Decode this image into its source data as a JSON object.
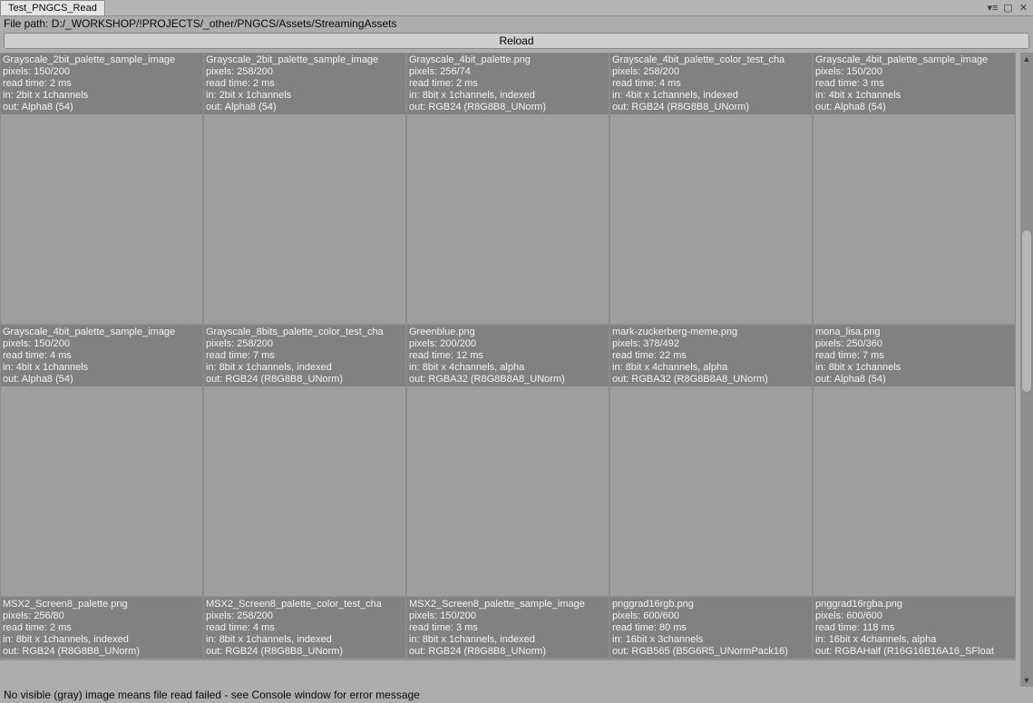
{
  "window": {
    "tab_title": "Test_PNGCS_Read"
  },
  "filepath_label": "File path: D:/_WORKSHOP/!PROJECTS/_other/PNGCS/Assets/StreamingAssets",
  "reload_label": "Reload",
  "footer_text": "No visible (gray) image means file read failed - see Console window for error message",
  "cells": [
    {
      "name": "Grayscale_2bit_palette_sample_image",
      "pixels": "150/200",
      "read_time": "2 ms",
      "in": "2bit x 1channels",
      "out": "Alpha8 (54)"
    },
    {
      "name": "Grayscale_2bit_palette_sample_image",
      "pixels": "258/200",
      "read_time": "2 ms",
      "in": "2bit x 1channels",
      "out": "Alpha8 (54)"
    },
    {
      "name": "Grayscale_4bit_palette.png",
      "pixels": "256/74",
      "read_time": "2 ms",
      "in": "8bit x 1channels, indexed",
      "out": "RGB24 (R8G8B8_UNorm)"
    },
    {
      "name": "Grayscale_4bit_palette_color_test_cha",
      "pixels": "258/200",
      "read_time": "4 ms",
      "in": "4bit x 1channels, indexed",
      "out": "RGB24 (R8G8B8_UNorm)"
    },
    {
      "name": "Grayscale_4bit_palette_sample_image",
      "pixels": "150/200",
      "read_time": "3 ms",
      "in": "4bit x 1channels",
      "out": "Alpha8 (54)"
    },
    {
      "name": "Grayscale_4bit_palette_sample_image",
      "pixels": "150/200",
      "read_time": "4 ms",
      "in": "4bit x 1channels",
      "out": "Alpha8 (54)"
    },
    {
      "name": "Grayscale_8bits_palette_color_test_cha",
      "pixels": "258/200",
      "read_time": "7 ms",
      "in": "8bit x 1channels, indexed",
      "out": "RGB24 (R8G8B8_UNorm)"
    },
    {
      "name": "Greenblue.png",
      "pixels": "200/200",
      "read_time": "12 ms",
      "in": "8bit x 4channels, alpha",
      "out": "RGBA32 (R8G8B8A8_UNorm)"
    },
    {
      "name": "mark-zuckerberg-meme.png",
      "pixels": "378/492",
      "read_time": "22 ms",
      "in": "8bit x 4channels, alpha",
      "out": "RGBA32 (R8G8B8A8_UNorm)"
    },
    {
      "name": "mona_lisa.png",
      "pixels": "250/360",
      "read_time": "7 ms",
      "in": "8bit x 1channels",
      "out": "Alpha8 (54)"
    },
    {
      "name": "MSX2_Screen8_palette.png",
      "pixels": "256/80",
      "read_time": "2 ms",
      "in": "8bit x 1channels, indexed",
      "out": "RGB24 (R8G8B8_UNorm)"
    },
    {
      "name": "MSX2_Screen8_palette_color_test_cha",
      "pixels": "258/200",
      "read_time": "4 ms",
      "in": "8bit x 1channels, indexed",
      "out": "RGB24 (R8G8B8_UNorm)"
    },
    {
      "name": "MSX2_Screen8_palette_sample_image",
      "pixels": "150/200",
      "read_time": "3 ms",
      "in": "8bit x 1channels, indexed",
      "out": "RGB24 (R8G8B8_UNorm)"
    },
    {
      "name": "pnggrad16rgb.png",
      "pixels": "600/600",
      "read_time": "80 ms",
      "in": "16bit x 3channels",
      "out": "RGB565 (B5G6R5_UNormPack16)"
    },
    {
      "name": "pnggrad16rgba.png",
      "pixels": "600/600",
      "read_time": "118 ms",
      "in": "16bit x 4channels, alpha",
      "out": "RGBAHalf (R16G16B16A16_SFloat"
    }
  ]
}
